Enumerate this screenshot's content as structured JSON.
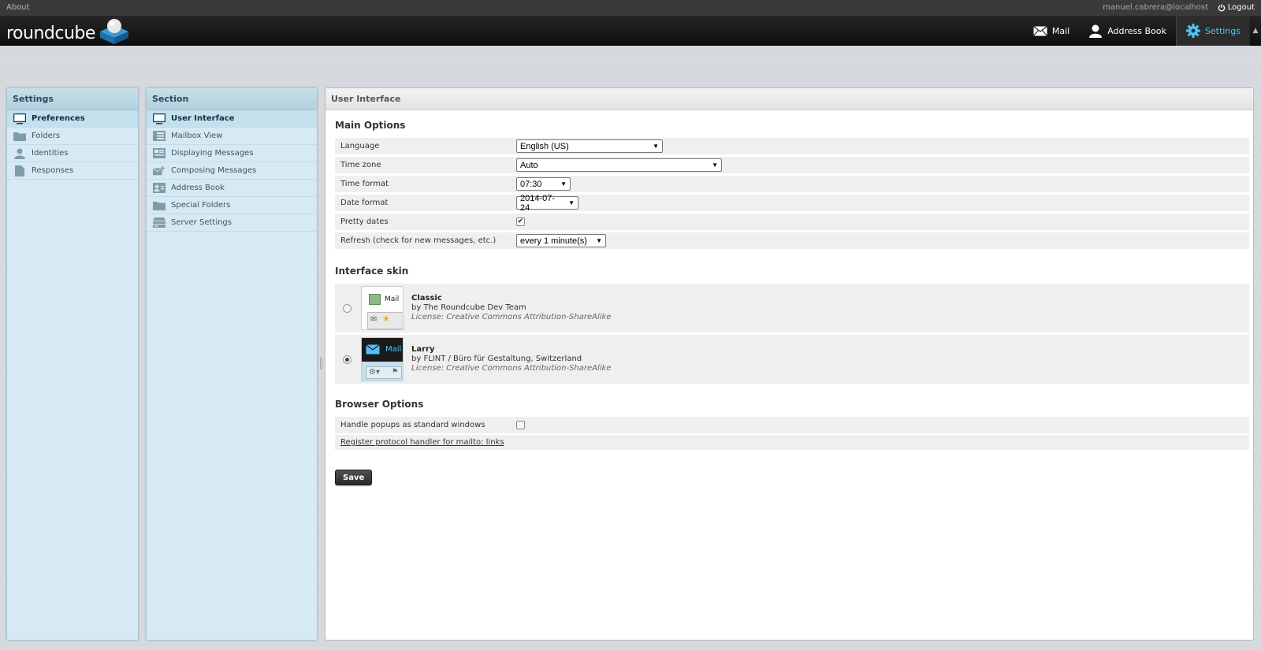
{
  "topbar": {
    "about_label": "About",
    "user_email": "manuel.cabrera@localhost",
    "logout_label": "Logout"
  },
  "header": {
    "logo_text": "roundcube",
    "nav": [
      {
        "label": "Mail",
        "icon": "mail-icon",
        "active": false
      },
      {
        "label": "Address Book",
        "icon": "person-icon",
        "active": false
      },
      {
        "label": "Settings",
        "icon": "gear-icon",
        "active": true
      }
    ]
  },
  "settings_panel": {
    "title": "Settings",
    "items": [
      {
        "label": "Preferences",
        "icon": "monitor-icon",
        "selected": true
      },
      {
        "label": "Folders",
        "icon": "folder-icon",
        "selected": false
      },
      {
        "label": "Identities",
        "icon": "person-icon",
        "selected": false
      },
      {
        "label": "Responses",
        "icon": "document-icon",
        "selected": false
      }
    ]
  },
  "section_panel": {
    "title": "Section",
    "items": [
      {
        "label": "User Interface",
        "icon": "monitor-icon",
        "selected": true
      },
      {
        "label": "Mailbox View",
        "icon": "list-view-icon",
        "selected": false
      },
      {
        "label": "Displaying Messages",
        "icon": "message-view-icon",
        "selected": false
      },
      {
        "label": "Composing Messages",
        "icon": "compose-icon",
        "selected": false
      },
      {
        "label": "Address Book",
        "icon": "contact-card-icon",
        "selected": false
      },
      {
        "label": "Special Folders",
        "icon": "folder-icon",
        "selected": false
      },
      {
        "label": "Server Settings",
        "icon": "server-icon",
        "selected": false
      }
    ]
  },
  "content": {
    "title": "User Interface",
    "main_options": {
      "heading": "Main Options",
      "language_label": "Language",
      "language_value": "English (US)",
      "timezone_label": "Time zone",
      "timezone_value": "Auto",
      "timeformat_label": "Time format",
      "timeformat_value": "07:30",
      "dateformat_label": "Date format",
      "dateformat_value": "2014-07-24",
      "prettydates_label": "Pretty dates",
      "prettydates_checked": true,
      "refresh_label": "Refresh (check for new messages, etc.)",
      "refresh_value": "every 1 minute(s)"
    },
    "interface_skin": {
      "heading": "Interface skin",
      "skins": [
        {
          "name": "Classic",
          "author": "by The Roundcube Dev Team",
          "license": "License: Creative Commons Attribution-ShareAlike",
          "thumb_label": "Mail",
          "selected": false
        },
        {
          "name": "Larry",
          "author": "by FLINT / Büro für Gestaltung, Switzerland",
          "license": "License: Creative Commons Attribution-ShareAlike",
          "thumb_label": "Mail",
          "selected": true
        }
      ]
    },
    "browser_options": {
      "heading": "Browser Options",
      "popups_label": "Handle popups as standard windows",
      "popups_checked": false,
      "protocol_link": "Register protocol handler for mailto: links"
    },
    "save_label": "Save"
  },
  "colors": {
    "accent": "#4fc3f7",
    "panel_bg": "#d7eaf3",
    "header_bg": "#1a1a1a"
  }
}
